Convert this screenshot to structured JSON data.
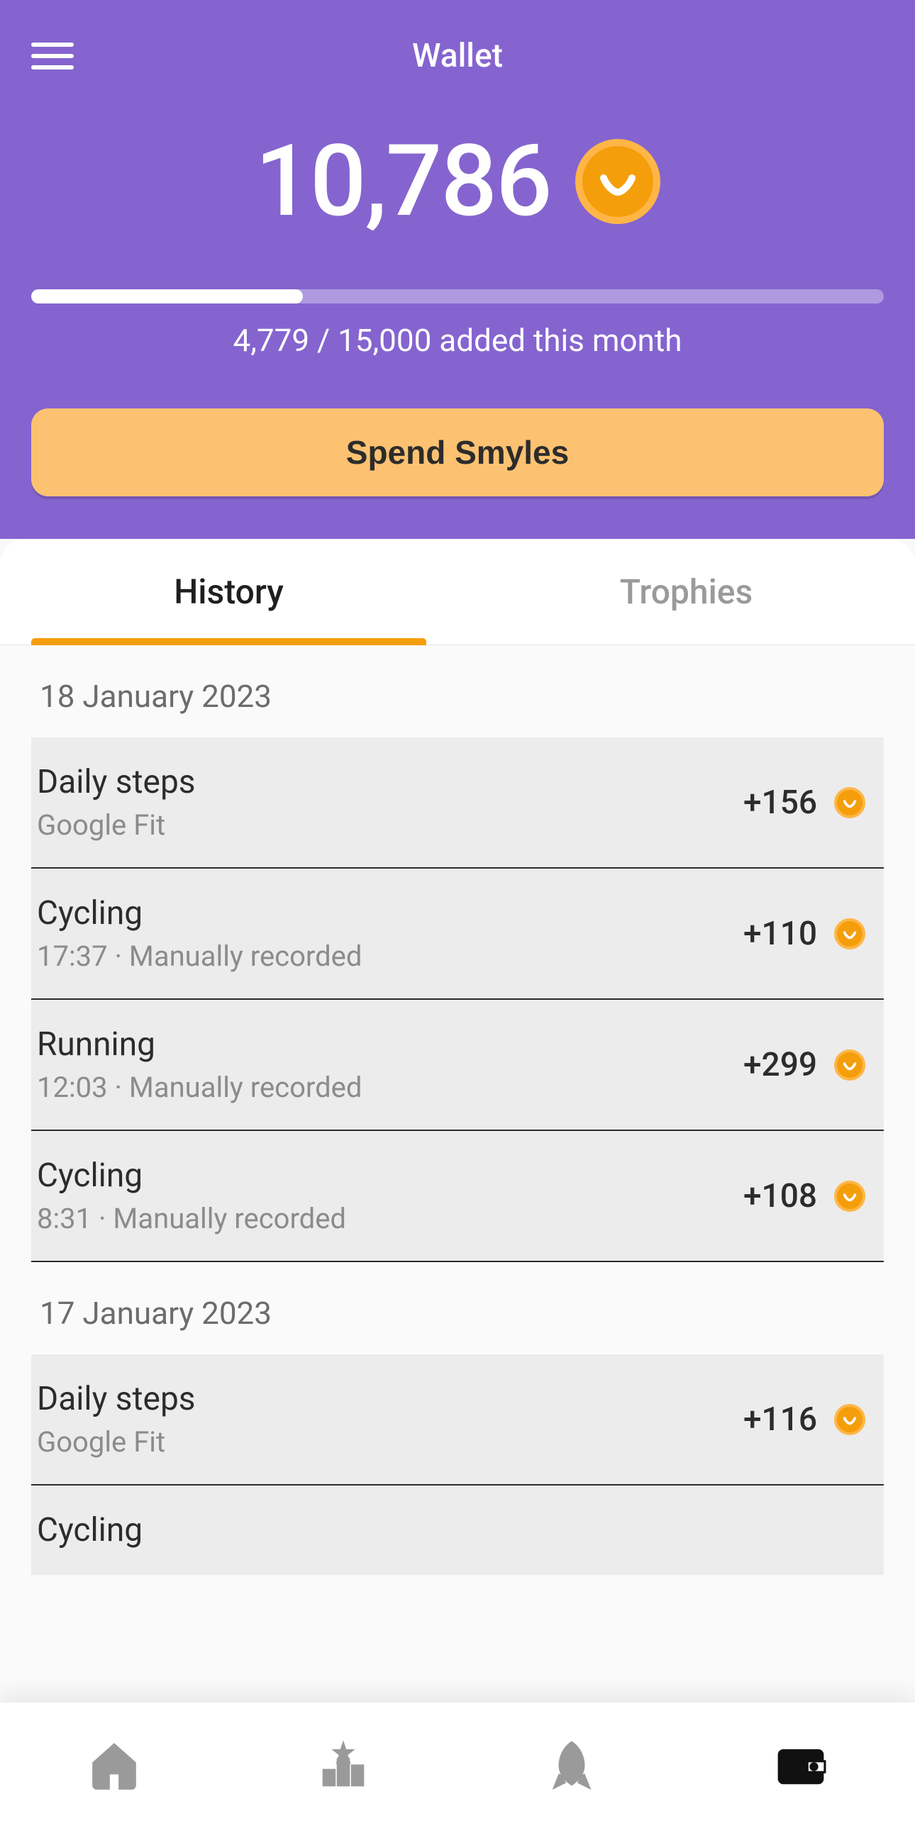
{
  "header": {
    "title": "Wallet",
    "balance": "10,786",
    "progress": {
      "current": 4779,
      "max": 15000,
      "label": "4,779 / 15,000 added this month",
      "percent": 31.86
    },
    "spend_label": "Spend Smyles"
  },
  "tabs": {
    "history": "History",
    "trophies": "Trophies",
    "active": "history"
  },
  "history": [
    {
      "type": "date",
      "label": "18 January 2023"
    },
    {
      "type": "entry",
      "title": "Daily steps",
      "sub": "Google Fit",
      "amount": "+156"
    },
    {
      "type": "entry",
      "title": "Cycling",
      "sub": "17:37 · Manually recorded",
      "amount": "+110"
    },
    {
      "type": "entry",
      "title": "Running",
      "sub": "12:03 · Manually recorded",
      "amount": "+299"
    },
    {
      "type": "entry",
      "title": "Cycling",
      "sub": "8:31 · Manually recorded",
      "amount": "+108"
    },
    {
      "type": "date",
      "label": "17 January 2023"
    },
    {
      "type": "entry",
      "title": "Daily steps",
      "sub": "Google Fit",
      "amount": "+116"
    },
    {
      "type": "entry_partial",
      "title": "Cycling",
      "sub": "",
      "amount": ""
    }
  ],
  "nav": {
    "items": [
      "home",
      "leaderboard",
      "boost",
      "wallet"
    ],
    "active": "wallet"
  },
  "colors": {
    "accent": "#8564cf",
    "coin": "#f59e0b"
  }
}
